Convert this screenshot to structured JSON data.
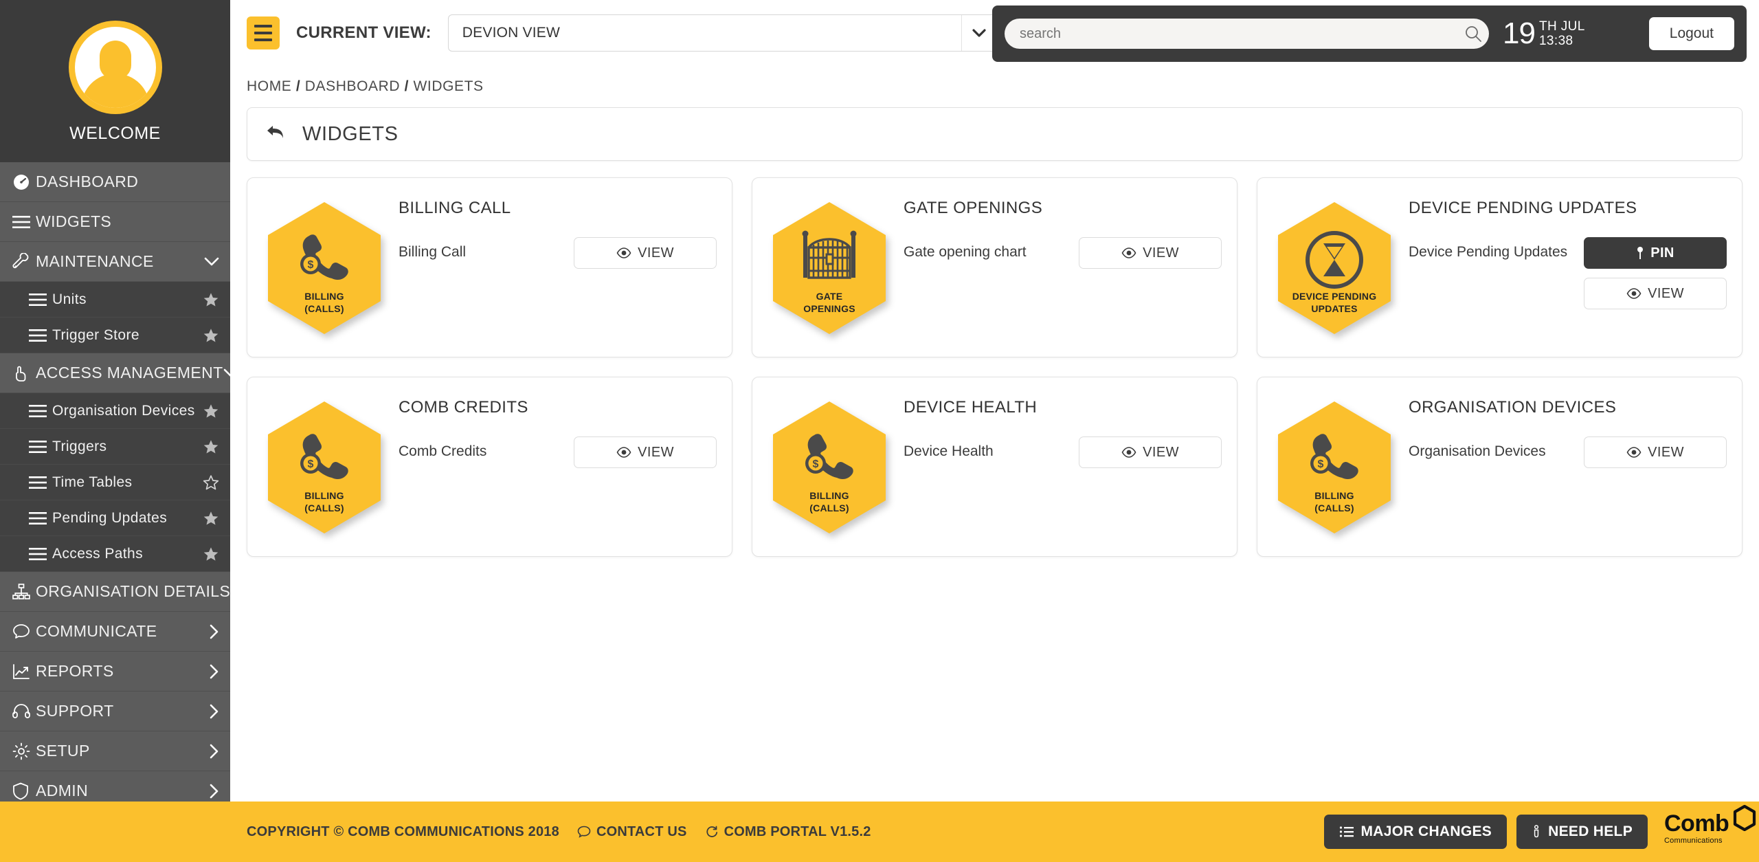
{
  "sidebar": {
    "welcome_label": "WELCOME",
    "avatar_icon": "user-avatar-icon",
    "items": [
      {
        "label": "DASHBOARD",
        "icon": "speedometer-icon",
        "type": "top",
        "right": "none",
        "active": true
      },
      {
        "label": "WIDGETS",
        "icon": "hamburger-icon",
        "type": "top",
        "right": "none",
        "active": true
      },
      {
        "label": "MAINTENANCE",
        "icon": "wrench-icon",
        "type": "top",
        "right": "chevron-down",
        "active": true
      },
      {
        "label": "Units",
        "icon": "hamburger-icon",
        "type": "sub",
        "right": "star-filled"
      },
      {
        "label": "Trigger Store",
        "icon": "hamburger-icon",
        "type": "sub",
        "right": "star-filled"
      },
      {
        "label": "ACCESS MANAGEMENT",
        "icon": "hand-pointer-icon",
        "type": "top",
        "right": "chevron-down",
        "active": true
      },
      {
        "label": "Organisation Devices",
        "icon": "hamburger-icon",
        "type": "sub",
        "right": "star-filled"
      },
      {
        "label": "Triggers",
        "icon": "hamburger-icon",
        "type": "sub",
        "right": "star-filled"
      },
      {
        "label": "Time Tables",
        "icon": "hamburger-icon",
        "type": "sub",
        "right": "star-outline"
      },
      {
        "label": "Pending Updates",
        "icon": "hamburger-icon",
        "type": "sub",
        "right": "star-filled"
      },
      {
        "label": "Access Paths",
        "icon": "hamburger-icon",
        "type": "sub",
        "right": "star-filled"
      },
      {
        "label": "ORGANISATION DETAILS",
        "icon": "sitemap-icon",
        "type": "top",
        "right": "chevron-right",
        "active": true
      },
      {
        "label": "COMMUNICATE",
        "icon": "chat-bubble-icon",
        "type": "top",
        "right": "chevron-right",
        "active": true
      },
      {
        "label": "REPORTS",
        "icon": "chart-line-icon",
        "type": "top",
        "right": "chevron-right",
        "active": true
      },
      {
        "label": "SUPPORT",
        "icon": "headset-icon",
        "type": "top",
        "right": "chevron-right",
        "active": true
      },
      {
        "label": "SETUP",
        "icon": "gear-icon",
        "type": "top",
        "right": "chevron-right",
        "active": true
      },
      {
        "label": "ADMIN",
        "icon": "shield-icon",
        "type": "top",
        "right": "chevron-right",
        "active": true
      }
    ]
  },
  "topbar": {
    "menu_icon": "hamburger-icon",
    "current_view_label": "CURRENT VIEW:",
    "current_view_value": "DEVION VIEW",
    "dropdown_icon": "chevron-down-icon"
  },
  "header": {
    "search_placeholder": "search",
    "search_value": "",
    "search_icon": "search-icon",
    "date_day": "19",
    "date_month": "TH JUL",
    "time": "13:38",
    "logout_label": "Logout"
  },
  "breadcrumb": {
    "home": "HOME",
    "dashboard": "DASHBOARD",
    "current": "WIDGETS",
    "separator": "/"
  },
  "page": {
    "back_icon": "back-arrow-icon",
    "title": "WIDGETS"
  },
  "widgets": [
    {
      "title": "BILLING CALL",
      "description": "Billing Call",
      "hex_label": "BILLING\n(CALLS)",
      "hex_line1": "BILLING",
      "hex_line2": "(CALLS)",
      "glyph": "phone-dollar-icon",
      "buttons": [
        {
          "label": "VIEW",
          "icon": "eye-icon",
          "style": "outline"
        }
      ]
    },
    {
      "title": "GATE OPENINGS",
      "description": "Gate opening chart",
      "hex_line1": "GATE",
      "hex_line2": "OPENINGS",
      "glyph": "gate-icon",
      "buttons": [
        {
          "label": "VIEW",
          "icon": "eye-icon",
          "style": "outline"
        }
      ]
    },
    {
      "title": "DEVICE PENDING UPDATES",
      "description": "Device Pending Updates",
      "hex_line1": "DEVICE PENDING",
      "hex_line2": "UPDATES",
      "glyph": "hourglass-icon",
      "buttons": [
        {
          "label": "PIN",
          "icon": "pin-icon",
          "style": "dark"
        },
        {
          "label": "VIEW",
          "icon": "eye-icon",
          "style": "outline"
        }
      ]
    },
    {
      "title": "COMB CREDITS",
      "description": "Comb Credits",
      "hex_line1": "BILLING",
      "hex_line2": "(CALLS)",
      "glyph": "phone-dollar-icon",
      "buttons": [
        {
          "label": "VIEW",
          "icon": "eye-icon",
          "style": "outline"
        }
      ]
    },
    {
      "title": "DEVICE HEALTH",
      "description": "Device Health",
      "hex_line1": "BILLING",
      "hex_line2": "(CALLS)",
      "glyph": "phone-dollar-icon",
      "buttons": [
        {
          "label": "VIEW",
          "icon": "eye-icon",
          "style": "outline"
        }
      ]
    },
    {
      "title": "ORGANISATION DEVICES",
      "description": "Organisation Devices",
      "hex_line1": "BILLING",
      "hex_line2": "(CALLS)",
      "glyph": "phone-dollar-icon",
      "buttons": [
        {
          "label": "VIEW",
          "icon": "eye-icon",
          "style": "outline"
        }
      ]
    }
  ],
  "footer": {
    "copyright": "COPYRIGHT © COMB COMMUNICATIONS 2018",
    "contact_label": "CONTACT US",
    "contact_icon": "chat-bubble-icon",
    "version_label": "COMB PORTAL V1.5.2",
    "version_icon": "refresh-icon",
    "major_changes_label": "MAJOR CHANGES",
    "major_changes_icon": "list-icon",
    "need_help_label": "NEED HELP",
    "need_help_icon": "info-icon",
    "logo_word": "Comb",
    "logo_sub": "Communications"
  },
  "colors": {
    "accent": "#fbc02d",
    "dark": "#3b3b3b",
    "sidebar_sub": "#414141",
    "sidebar_top": "#5c5c5c"
  }
}
